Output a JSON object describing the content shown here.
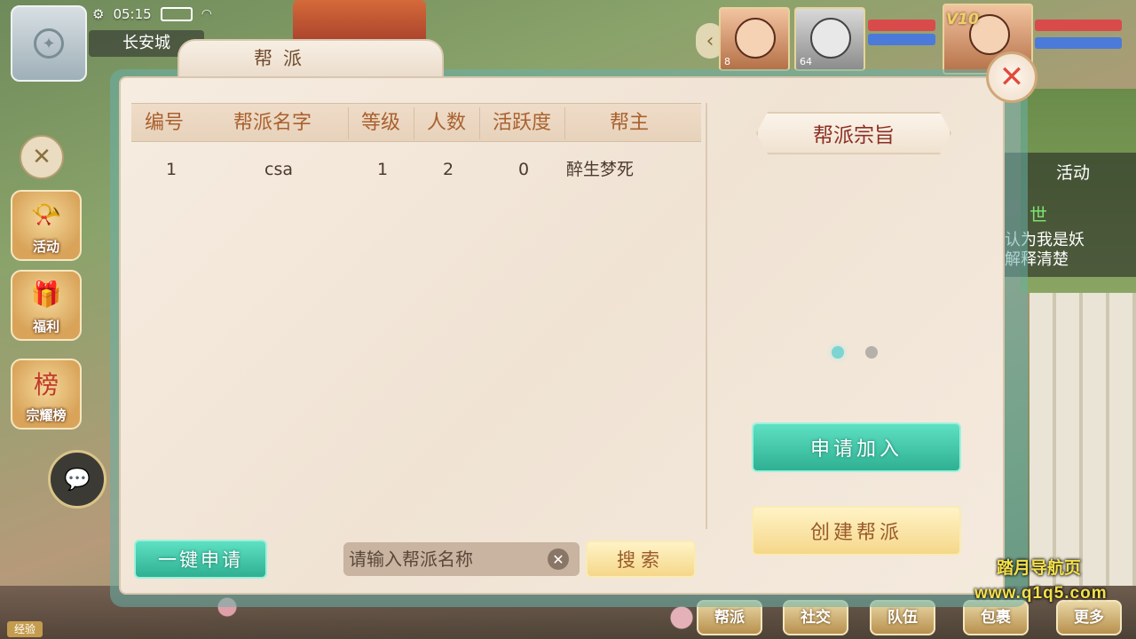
{
  "hud": {
    "time": "05:15",
    "location": "长安城",
    "vip_level": "V10",
    "portraits": [
      {
        "level": "8"
      },
      {
        "level": "64"
      },
      {
        "level": ""
      }
    ]
  },
  "side_menu": {
    "items": [
      {
        "label": "活动",
        "icon": "horn-icon"
      },
      {
        "label": "福利",
        "icon": "gift-icon"
      },
      {
        "label": "宗耀榜",
        "icon": "ranking-icon"
      }
    ]
  },
  "activity_panel": {
    "tab": "活动",
    "line1": "世",
    "line2": "认为我是妖",
    "line3": "解释清楚"
  },
  "bottom_bar": {
    "items": [
      "帮派",
      "社交",
      "队伍",
      "包裹",
      "更多"
    ],
    "exp_label": "经验"
  },
  "modal": {
    "title": "帮派",
    "table": {
      "headers": [
        "编号",
        "帮派名字",
        "等级",
        "人数",
        "活跃度",
        "帮主"
      ],
      "rows": [
        {
          "id": "1",
          "name": "csa",
          "level": "1",
          "members": "2",
          "activity": "0",
          "leader": "醉生梦死"
        }
      ]
    },
    "purpose_label": "帮派宗旨",
    "apply_button": "申请加入",
    "create_button": "创建帮派",
    "quick_apply_button": "一键申请",
    "search": {
      "placeholder": "请输入帮派名称",
      "value": "",
      "button": "搜索"
    },
    "page_dots": {
      "count": 2,
      "active": 0
    }
  },
  "watermark": {
    "line1": "踏月导航页",
    "line2": "www.q1q5.com"
  },
  "colors": {
    "teal_button": "#3cc3a3",
    "gold_button": "#f5d78a",
    "header_text": "#a9612f",
    "close_red": "#e04a3b"
  }
}
